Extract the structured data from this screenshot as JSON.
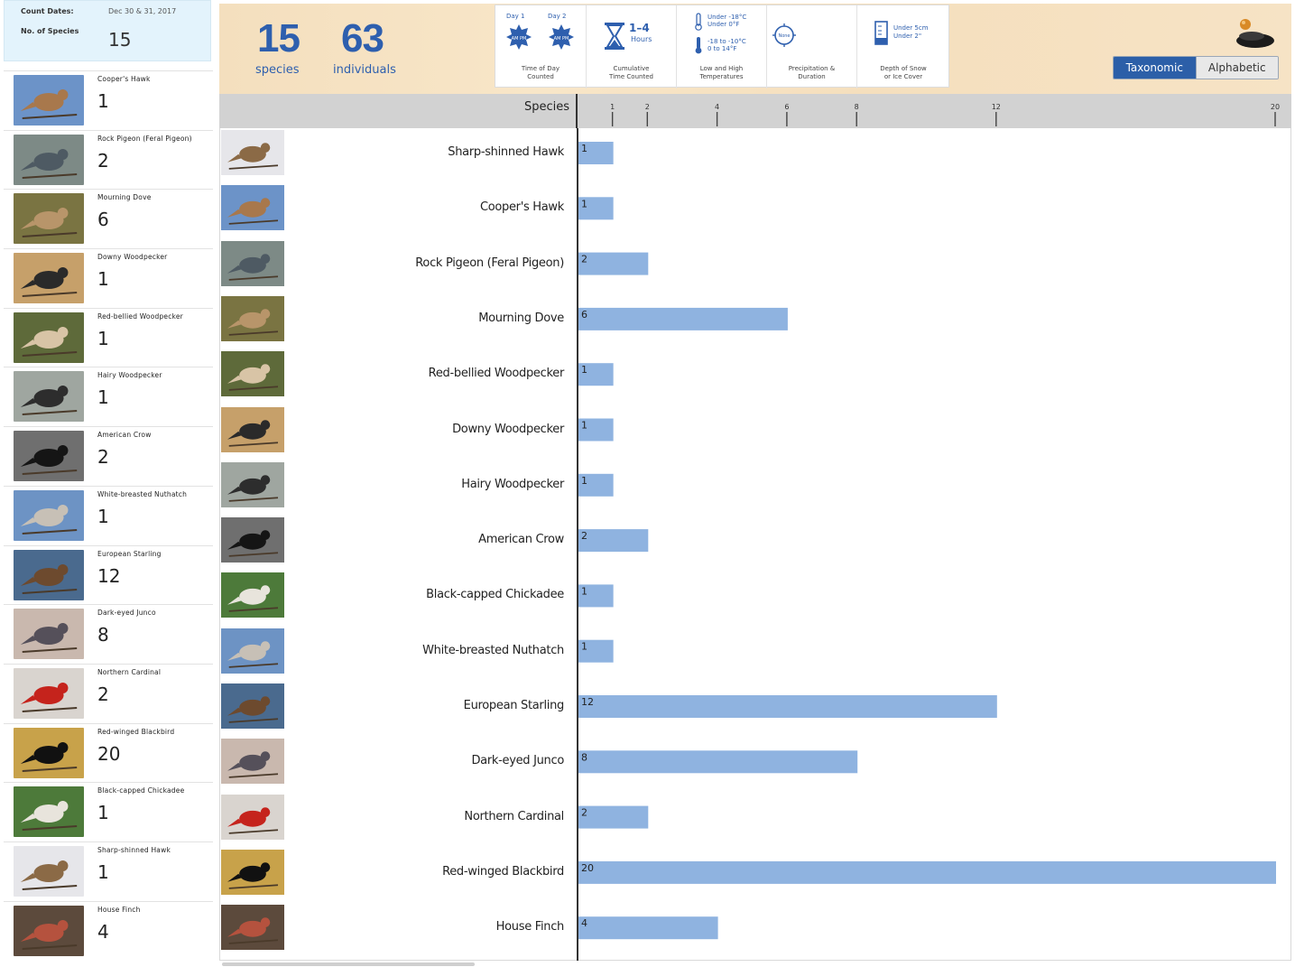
{
  "count_box": {
    "dates_label": "Count Dates:",
    "dates_value": "Dec 30 & 31, 2017",
    "species_label": "No. of Species",
    "species_value": "15"
  },
  "sidebar_items": [
    {
      "name": "Cooper's Hawk",
      "count": "1",
      "palette": [
        "#6c93c8",
        "#a8784c"
      ]
    },
    {
      "name": "Rock Pigeon (Feral Pigeon)",
      "count": "2",
      "palette": [
        "#7d8a86",
        "#4e5a63"
      ]
    },
    {
      "name": "Mourning Dove",
      "count": "6",
      "palette": [
        "#7a7442",
        "#b8956a"
      ]
    },
    {
      "name": "Downy Woodpecker",
      "count": "1",
      "palette": [
        "#c6a06a",
        "#2a2a2a"
      ]
    },
    {
      "name": "Red-bellied Woodpecker",
      "count": "1",
      "palette": [
        "#5e6a3a",
        "#d8c4a6"
      ]
    },
    {
      "name": "Hairy Woodpecker",
      "count": "1",
      "palette": [
        "#9fa6a0",
        "#2d2d2d"
      ]
    },
    {
      "name": "American Crow",
      "count": "2",
      "palette": [
        "#6f6f6f",
        "#151515"
      ]
    },
    {
      "name": "White-breasted Nuthatch",
      "count": "1",
      "palette": [
        "#6d93c4",
        "#c7c0b6"
      ]
    },
    {
      "name": "European Starling",
      "count": "12",
      "palette": [
        "#4a6a8e",
        "#6d4a2e"
      ]
    },
    {
      "name": "Dark-eyed Junco",
      "count": "8",
      "palette": [
        "#c9b8ae",
        "#55505a"
      ]
    },
    {
      "name": "Northern Cardinal",
      "count": "2",
      "palette": [
        "#d9d4cf",
        "#c5231c"
      ]
    },
    {
      "name": "Red-winged Blackbird",
      "count": "20",
      "palette": [
        "#c8a24a",
        "#111111"
      ]
    },
    {
      "name": "Black-capped Chickadee",
      "count": "1",
      "palette": [
        "#4d7a3a",
        "#e8e4dc"
      ]
    },
    {
      "name": "Sharp-shinned Hawk",
      "count": "1",
      "palette": [
        "#e6e6ea",
        "#8b6a46"
      ]
    },
    {
      "name": "House Finch",
      "count": "4",
      "palette": [
        "#5c4a3c",
        "#b5523e"
      ]
    }
  ],
  "header": {
    "species_number": "15",
    "species_label": "species",
    "individuals_number": "63",
    "individuals_label": "individuals",
    "day1": "Day 1",
    "day2": "Day 2",
    "am_pm_1": "AM PM",
    "am_pm_2": "AM PM",
    "time_of_day_caption": "Time of Day\nCounted",
    "hours_value": "1–4",
    "hours_label": "Hours",
    "cumulative_caption": "Cumulative\nTime Counted",
    "temp_low_1": "Under -18°C",
    "temp_low_2": "Under 0°F",
    "temp_high_1": "-18 to -10°C",
    "temp_high_2": "0 to 14°F",
    "temp_caption": "Low and High\nTemperatures",
    "precip_icon_label": "None",
    "precip_caption": "Precipitation &\nDuration",
    "snow_1": "Under 5cm",
    "snow_2": "Under 2\"",
    "snow_caption": "Depth of Snow\nor Ice Cover",
    "toggle_taxonomic": "Taxonomic",
    "toggle_alphabetic": "Alphabetic"
  },
  "chart_header": {
    "species_label": "Species"
  },
  "chart_data": {
    "type": "bar",
    "orientation": "horizontal",
    "categories": [
      "Sharp-shinned Hawk",
      "Cooper's Hawk",
      "Rock Pigeon (Feral Pigeon)",
      "Mourning Dove",
      "Red-bellied Woodpecker",
      "Downy Woodpecker",
      "Hairy Woodpecker",
      "American Crow",
      "Black-capped Chickadee",
      "White-breasted Nuthatch",
      "European Starling",
      "Dark-eyed Junco",
      "Northern Cardinal",
      "Red-winged Blackbird",
      "House Finch"
    ],
    "values": [
      1,
      1,
      2,
      6,
      1,
      1,
      1,
      2,
      1,
      1,
      12,
      8,
      2,
      20,
      4
    ],
    "ticks": [
      1,
      2,
      4,
      6,
      8,
      12,
      20
    ],
    "xlim": [
      0,
      20
    ],
    "bar_color": "#8fb3e0",
    "row_palettes": [
      [
        "#e6e6ea",
        "#8b6a46"
      ],
      [
        "#6c93c8",
        "#a8784c"
      ],
      [
        "#7d8a86",
        "#4e5a63"
      ],
      [
        "#7a7442",
        "#b8956a"
      ],
      [
        "#5e6a3a",
        "#d8c4a6"
      ],
      [
        "#c6a06a",
        "#2a2a2a"
      ],
      [
        "#9fa6a0",
        "#2d2d2d"
      ],
      [
        "#6f6f6f",
        "#151515"
      ],
      [
        "#4d7a3a",
        "#e8e4dc"
      ],
      [
        "#6d93c4",
        "#c7c0b6"
      ],
      [
        "#4a6a8e",
        "#6d4a2e"
      ],
      [
        "#c9b8ae",
        "#55505a"
      ],
      [
        "#d9d4cf",
        "#c5231c"
      ],
      [
        "#c8a24a",
        "#111111"
      ],
      [
        "#5c4a3c",
        "#b5523e"
      ]
    ]
  },
  "colors": {
    "accent": "#2e5fae",
    "header_bg": "#f6e2c3",
    "count_box_bg": "#e3f3fc"
  }
}
